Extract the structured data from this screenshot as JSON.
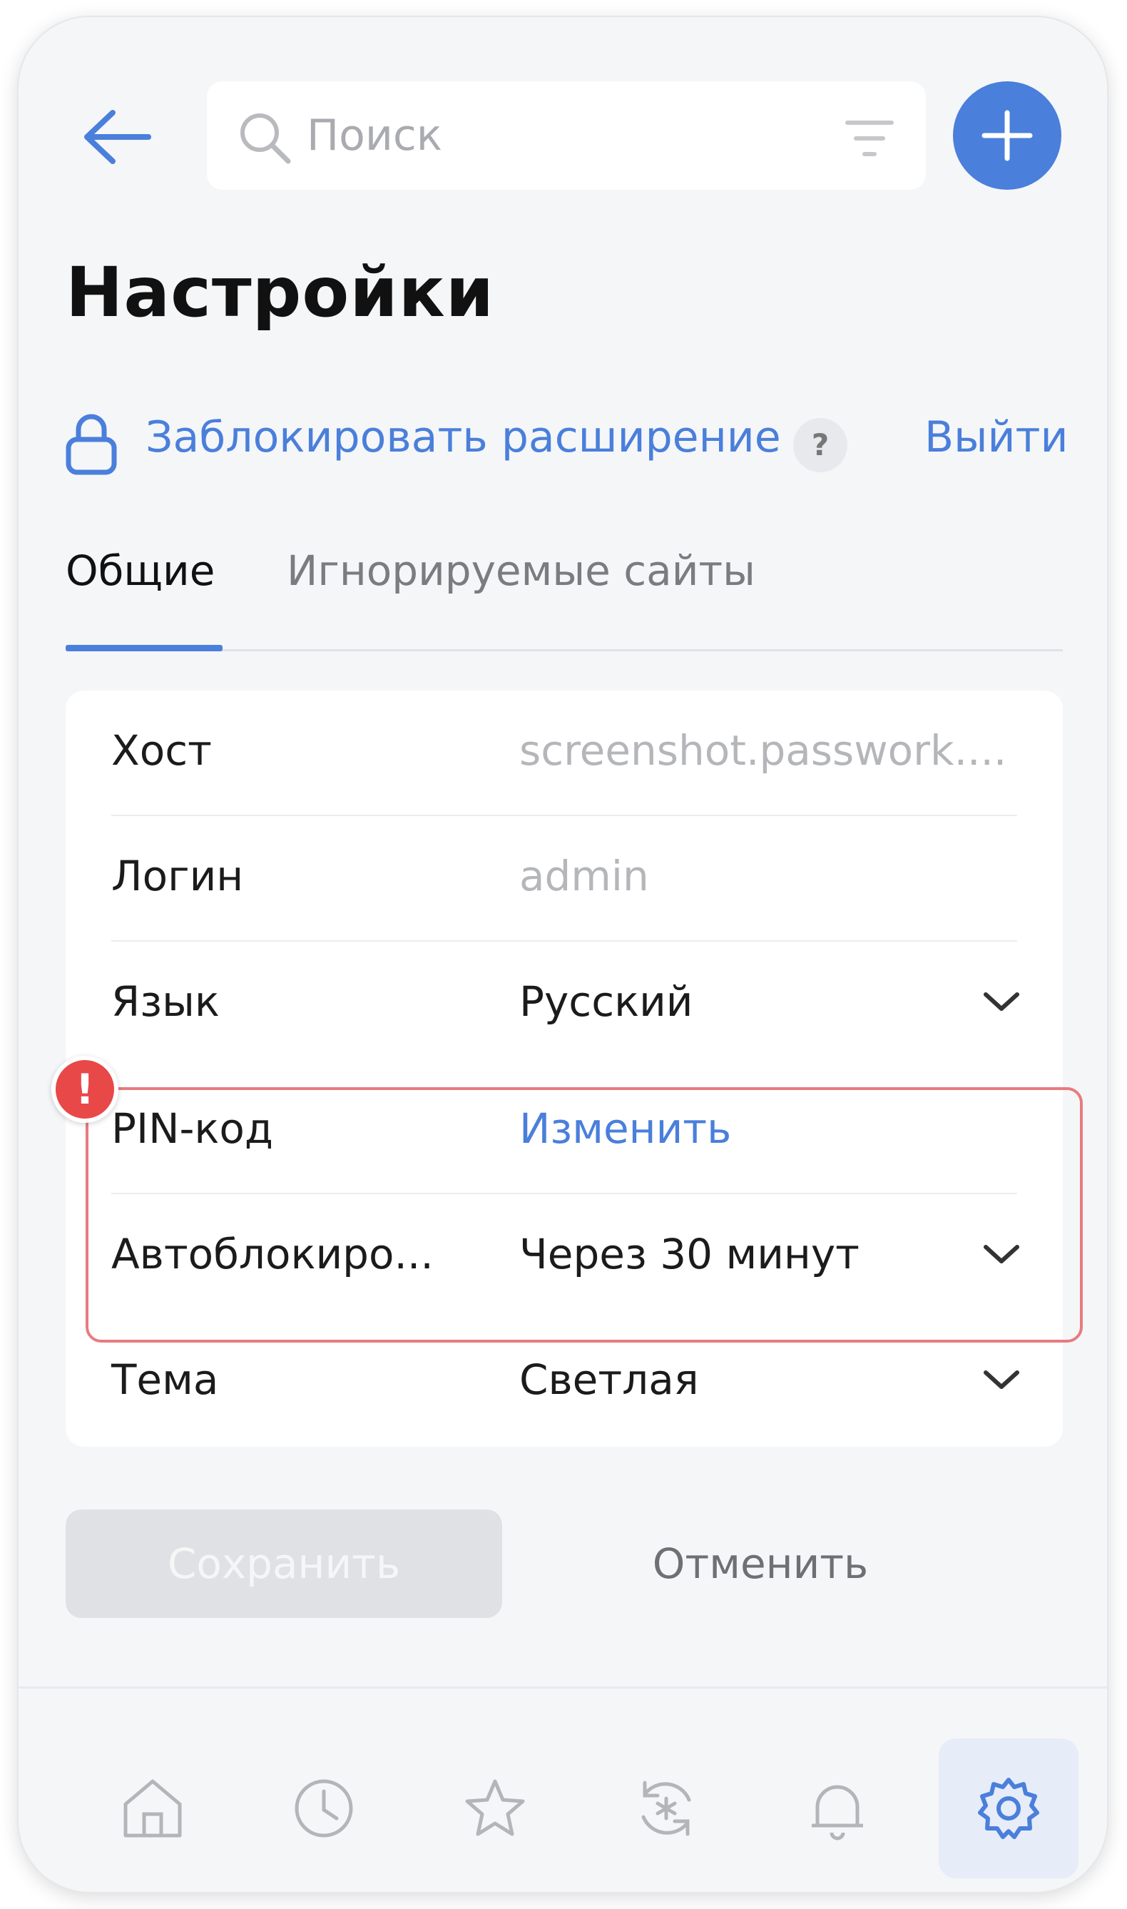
{
  "header": {
    "search_placeholder": "Поиск"
  },
  "page": {
    "title": "Настройки",
    "lock_label": "Заблокировать расширение",
    "help_label": "?",
    "logout_label": "Выйти"
  },
  "tabs": [
    {
      "label": "Общие",
      "active": true
    },
    {
      "label": "Игнорируемые сайты",
      "active": false
    }
  ],
  "settings": {
    "host": {
      "label": "Хост",
      "value": "screenshot.passwork...."
    },
    "login": {
      "label": "Логин",
      "value": "admin"
    },
    "language": {
      "label": "Язык",
      "value": "Русский"
    },
    "pin": {
      "label": "PIN-код",
      "value": "Изменить"
    },
    "autolock": {
      "label": "Автоблокиро...",
      "value": "Через 30 минут"
    },
    "theme": {
      "label": "Тема",
      "value": "Светлая"
    }
  },
  "warning_badge": "!",
  "actions": {
    "save_label": "Сохранить",
    "cancel_label": "Отменить"
  },
  "bottom_nav": [
    {
      "icon": "home-icon",
      "active": false
    },
    {
      "icon": "clock-icon",
      "active": false
    },
    {
      "icon": "star-icon",
      "active": false
    },
    {
      "icon": "password-generator-icon",
      "active": false
    },
    {
      "icon": "bell-icon",
      "active": false
    },
    {
      "icon": "gear-icon",
      "active": true
    }
  ],
  "colors": {
    "accent": "#4a7fdb",
    "warning": "#e84848",
    "highlight_border": "#e87b7e",
    "background": "#f5f6f8"
  }
}
